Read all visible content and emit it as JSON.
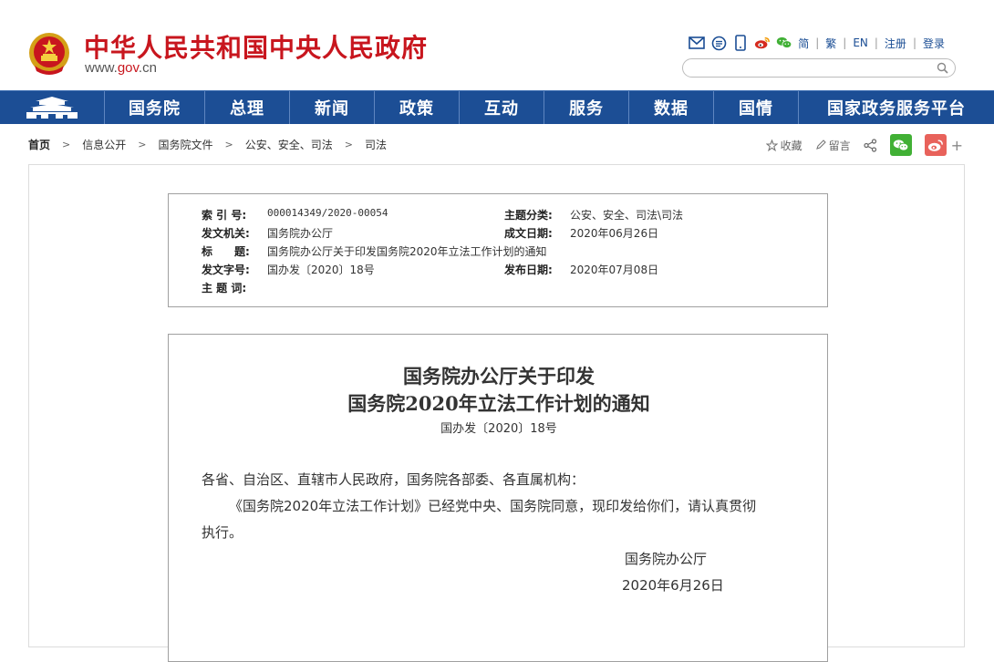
{
  "header": {
    "title": "中华人民共和国中央人民政府",
    "url_prefix": "www.",
    "url_brand": "gov",
    "url_suffix": ".cn",
    "links": [
      "简",
      "繁",
      "EN",
      "注册",
      "登录"
    ],
    "icons": [
      "mail-icon",
      "chat-icon",
      "mobile-icon",
      "weibo-icon",
      "wechat-icon"
    ],
    "search_placeholder": ""
  },
  "nav": {
    "items": [
      "国务院",
      "总理",
      "新闻",
      "政策",
      "互动",
      "服务",
      "数据",
      "国情",
      "国家政务服务平台"
    ]
  },
  "breadcrumb": {
    "items": [
      "首页",
      "信息公开",
      "国务院文件",
      "公安、安全、司法",
      "司法"
    ]
  },
  "actions": {
    "favorite": "收藏",
    "comment": "留言"
  },
  "meta": {
    "index_label": "索 引 号:",
    "index_value": "000014349/2020-00054",
    "topic_label": "主题分类:",
    "topic_value": "公安、安全、司法\\司法",
    "issuer_label": "发文机关:",
    "issuer_value": "国务院办公厅",
    "created_label": "成文日期:",
    "created_value": "2020年06月26日",
    "title_label": "标　　题:",
    "title_value": "国务院办公厅关于印发国务院2020年立法工作计划的通知",
    "docno_label": "发文字号:",
    "docno_value": "国办发〔2020〕18号",
    "published_label": "发布日期:",
    "published_value": "2020年07月08日",
    "keywords_label": "主 题 词:",
    "keywords_value": ""
  },
  "doc": {
    "title_line1": "国务院办公厅关于印发",
    "title_line2": "国务院2020年立法工作计划的通知",
    "number": "国办发〔2020〕18号",
    "salutation": "各省、自治区、直辖市人民政府，国务院各部委、各直属机构：",
    "para1_line1": "《国务院2020年立法工作计划》已经党中央、国务院同意，现印发给你们，请认真贯彻",
    "para1_line2": "执行。",
    "signer": "国务院办公厅",
    "date": "2020年6月26日"
  },
  "colors": {
    "brand_red": "#c8161e",
    "nav_blue": "#1c4e95",
    "link_blue": "#1a4d94"
  }
}
